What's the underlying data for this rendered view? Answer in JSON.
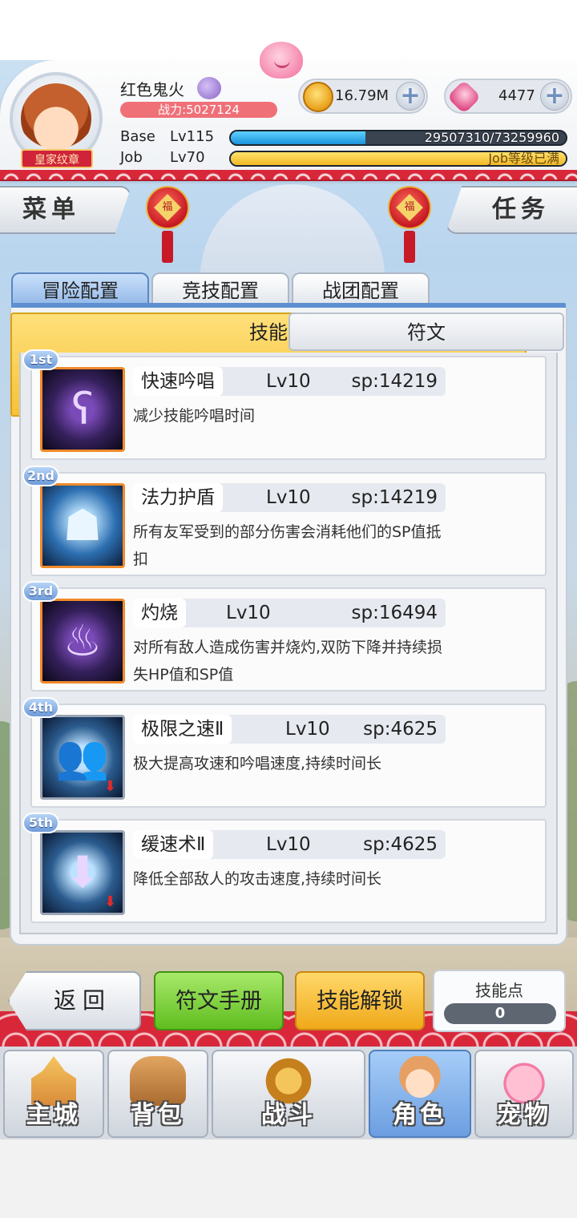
{
  "player": {
    "name": "红色鬼火",
    "power": "战力:5027124",
    "badge": "皇家纹章",
    "base_label": "Base",
    "base_level": "Lv115",
    "base_exp": "29507310/73259960",
    "base_exp_fraction": 0.403,
    "job_label": "Job",
    "job_level": "Lv70",
    "job_exp": "Job等级已满",
    "job_exp_fraction": 1.0
  },
  "currency": {
    "gold": "16.79M",
    "gems": "4477",
    "plus_glyph": "+"
  },
  "side_menu": {
    "left": "菜单",
    "right": "任务"
  },
  "lantern_glyph": "福",
  "config_tabs": [
    "冒险配置",
    "竞技配置",
    "战团配置"
  ],
  "sub_tabs": [
    "技能",
    "符文"
  ],
  "skills": [
    {
      "rank": "1st",
      "name": "快速吟唱",
      "level": "Lv10",
      "sp": "sp:14219",
      "desc": "减少技能吟唱时间",
      "icon": "chant-rune-icon",
      "glyph": "ʕ"
    },
    {
      "rank": "2nd",
      "name": "法力护盾",
      "level": "Lv10",
      "sp": "sp:14219",
      "desc": "所有友军受到的部分伤害会消耗他们的SP值抵扣",
      "icon": "mana-shield-icon",
      "glyph": "☗"
    },
    {
      "rank": "3rd",
      "name": "灼烧",
      "level": "Lv10",
      "sp": "sp:16494",
      "desc": "对所有敌人造成伤害并烧灼,双防下降并持续损失HP值和SP值",
      "icon": "burn-flame-icon",
      "glyph": "♨"
    },
    {
      "rank": "4th",
      "name": "极限之速Ⅱ",
      "level": "Lv10",
      "sp": "sp:4625",
      "desc": "极大提高攻速和吟唱速度,持续时间长",
      "icon": "extreme-speed-icon",
      "glyph": "👥"
    },
    {
      "rank": "5th",
      "name": "缓速术Ⅱ",
      "level": "Lv10",
      "sp": "sp:4625",
      "desc": "降低全部敌人的攻击速度,持续时间长",
      "icon": "slow-spell-icon",
      "glyph": "⬇"
    }
  ],
  "down_arrow": "⬇",
  "bottom_actions": {
    "back": "返回",
    "rune_manual": "符文手册",
    "skill_unlock": "技能解锁",
    "skill_points_label": "技能点",
    "skill_points_value": "0"
  },
  "nav": [
    "主城",
    "背包",
    "战斗",
    "角色",
    "宠物"
  ],
  "colors": {
    "accent_blue": "#5e8fd0",
    "festive_red": "#d9273a",
    "skill_tab_yellow": "#f6c238",
    "green_button": "#5fbd1f"
  }
}
